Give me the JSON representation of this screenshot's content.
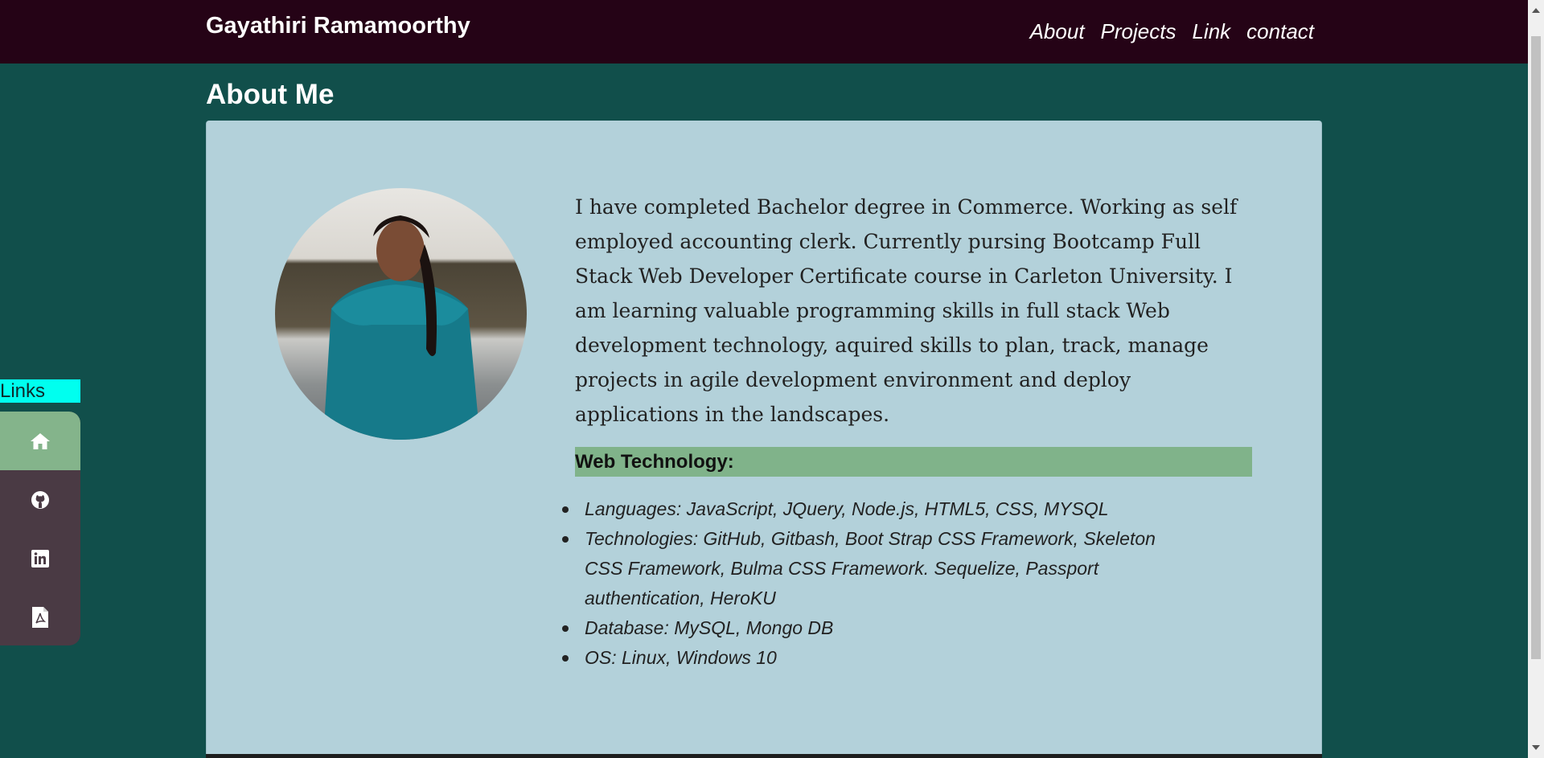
{
  "header": {
    "brand": "Gayathiri Ramamoorthy",
    "nav": [
      {
        "label": "About"
      },
      {
        "label": "Projects"
      },
      {
        "label": "Link"
      },
      {
        "label": "contact"
      }
    ]
  },
  "about": {
    "title": "About Me",
    "bio": "I have completed Bachelor degree in Commerce. Working as self employed accounting clerk. Currently pursing Bootcamp Full Stack Web Developer Certificate course in Carleton University. I am learning valuable programming skills in full stack Web development technology, aquired skills to plan, track, manage projects in agile development environment and deploy applications in the landscapes.",
    "tech_heading": "Web Technology:",
    "tech_items": [
      {
        "text": "Languages: JavaScript, JQuery, Node.js, HTML5, CSS, MYSQL"
      },
      {
        "text": "Technologies: GitHub, Gitbash, Boot Strap CSS Framework, Skeleton CSS Framework, Bulma CSS Framework. Sequelize, Passport authentication, HeroKU"
      },
      {
        "text": "Database: MySQL, Mongo DB"
      },
      {
        "text": "OS: Linux, Windows 10"
      }
    ]
  },
  "sidebar": {
    "label": "Links",
    "items": [
      {
        "icon": "home-icon"
      },
      {
        "icon": "github-icon"
      },
      {
        "icon": "linkedin-icon"
      },
      {
        "icon": "pdf-icon"
      }
    ]
  },
  "colors": {
    "navbar": "#250316",
    "page_bg": "#114f4b",
    "card_bg": "#b3d1da",
    "heading_bar": "#80b38a",
    "sidebar_label_bg": "#00ffef",
    "sidebar_bg": "#4a3a44"
  }
}
